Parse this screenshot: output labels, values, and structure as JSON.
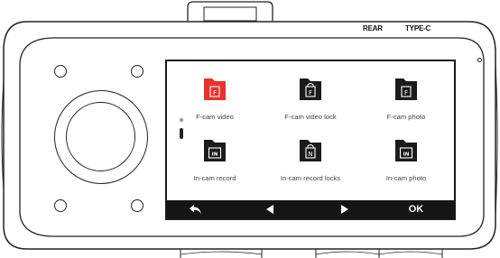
{
  "device": {
    "ports": {
      "rear_label": "REAR",
      "typec_label": "TYPE-C"
    }
  },
  "screen": {
    "tiles": [
      {
        "label": "F-cam video",
        "badge": "F",
        "icon": "folder-front-video-icon",
        "selected": true
      },
      {
        "label": "F-cam video lock",
        "badge": "F",
        "icon": "folder-front-video-lock-icon",
        "selected": false
      },
      {
        "label": "F-cam photo",
        "badge": "F",
        "icon": "folder-front-photo-icon",
        "selected": false
      },
      {
        "label": "In-cam record",
        "badge": "IN",
        "icon": "folder-cabin-record-icon",
        "selected": false
      },
      {
        "label": "In-cam record locks",
        "badge": "N",
        "icon": "folder-cabin-record-lock-icon",
        "selected": false
      },
      {
        "label": "In-cam photo",
        "badge": "IN",
        "icon": "folder-cabin-photo-icon",
        "selected": false
      }
    ],
    "softkeys": {
      "back_icon": "back-arrow-icon",
      "prev_icon": "left-triangle-icon",
      "next_icon": "right-triangle-icon",
      "ok_label": "OK"
    }
  },
  "colors": {
    "selected_folder": "#e8322b",
    "folder": "#1b1b1b",
    "softkey_bar": "#151515",
    "caption_text": "#444444"
  }
}
